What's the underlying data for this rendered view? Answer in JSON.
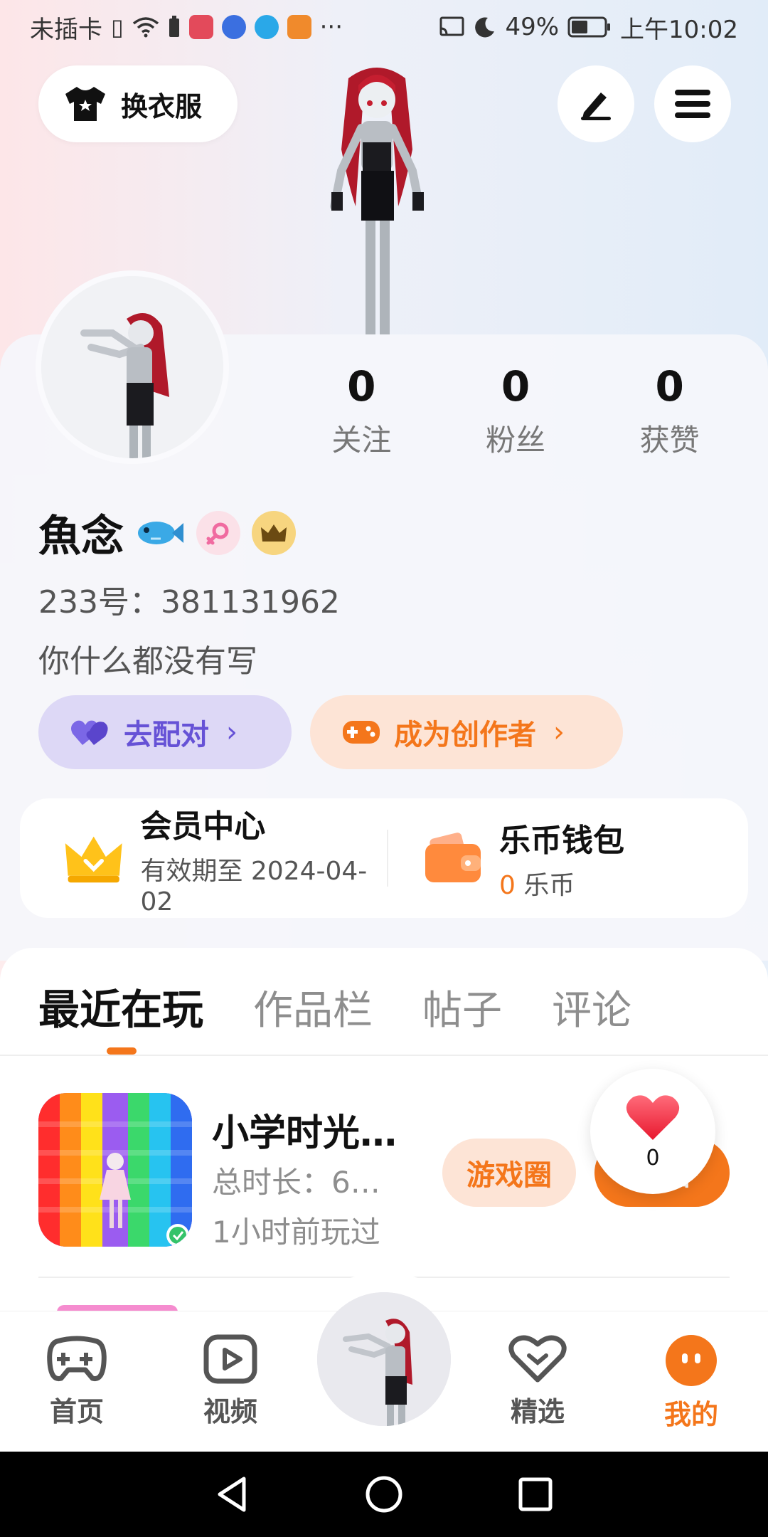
{
  "status_bar": {
    "carrier": "未插卡",
    "battery": "49%",
    "time": "上午10:02",
    "more": "···"
  },
  "top": {
    "wardrobe_label": "换衣服",
    "edit_icon": "pen-icon",
    "menu_icon": "menu-icon"
  },
  "profile": {
    "stats": [
      {
        "value": "0",
        "label": "关注"
      },
      {
        "value": "0",
        "label": "粉丝"
      },
      {
        "value": "0",
        "label": "获赞"
      }
    ],
    "name": "魚念",
    "uid": "233号：381131962",
    "bio": "你什么都没有写",
    "match_label": "去配对",
    "creator_label": "成为创作者"
  },
  "member": {
    "title": "会员中心",
    "subtitle": "有效期至 2024-04-02"
  },
  "wallet": {
    "title": "乐币钱包",
    "amount": "0",
    "unit": "乐币"
  },
  "tabs": [
    "最近在玩",
    "作品栏",
    "帖子",
    "评论"
  ],
  "recent_game": {
    "title": "小学时光…",
    "duration": "总时长：6…",
    "last_played": "1小时前玩过",
    "circle_label": "游戏圈",
    "play_label": "开始"
  },
  "like": {
    "count": "0"
  },
  "bottom_nav": [
    {
      "label": "首页",
      "icon": "gamepad-icon"
    },
    {
      "label": "视频",
      "icon": "video-icon"
    },
    {
      "label": "精选",
      "icon": "heart-icon"
    },
    {
      "label": "我的",
      "icon": "profile-face-icon"
    }
  ],
  "colors": {
    "accent": "#f4761b",
    "purple": "#6652d6"
  }
}
